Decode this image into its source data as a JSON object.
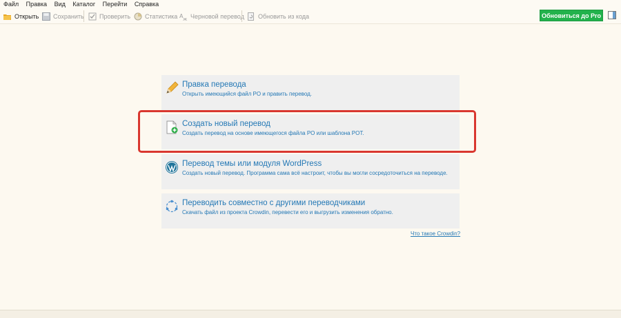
{
  "menu": [
    "Файл",
    "Правка",
    "Вид",
    "Каталог",
    "Перейти",
    "Справка"
  ],
  "toolbar": {
    "open": "Открыть",
    "save": "Сохранить",
    "validate": "Проверить",
    "stats": "Статистика",
    "rough": "Черновой перевод",
    "update": "Обновить из кода",
    "pro": "Обновиться до Pro"
  },
  "cards": [
    {
      "title": "Правка перевода",
      "desc": "Открыть имеющийся файл PO и править перевод.",
      "icon": "pencil-icon"
    },
    {
      "title": "Создать новый перевод",
      "desc": "Создать перевод на основе имеющегося файла PO или шаблона POT.",
      "icon": "new-file-icon"
    },
    {
      "title": "Перевод темы или модуля WordPress",
      "desc": "Создать новый перевод. Программа сама всё настроит, чтобы вы могли сосредоточиться на переводе.",
      "icon": "wordpress-icon"
    },
    {
      "title": "Переводить совместно с другими переводчиками",
      "desc": "Скачать файл из проекта Crowdin, перевести его и выгрузить изменения обратно.",
      "icon": "crowdin-icon"
    }
  ],
  "crowdin_link": "Что такое Crowdin?",
  "colors": {
    "accent": "#2478b5",
    "pro": "#22b24c",
    "highlight": "#d9372f"
  }
}
